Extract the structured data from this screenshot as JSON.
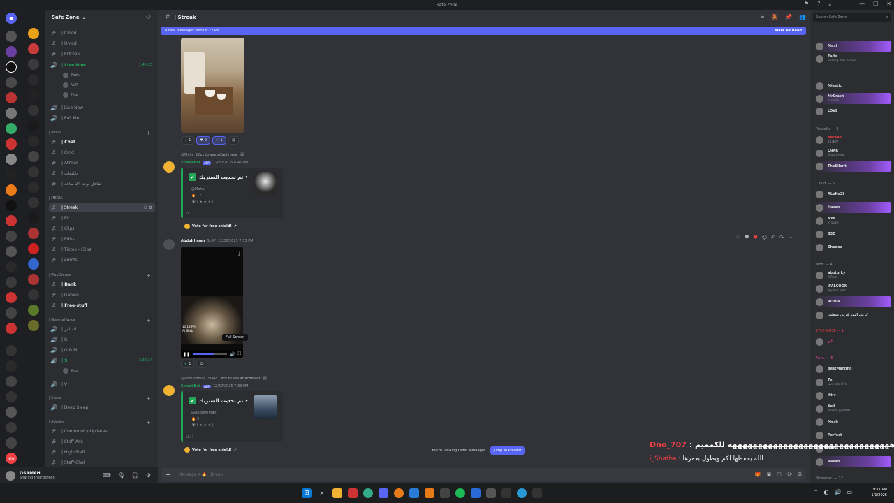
{
  "window": {
    "title": "Safe Zone"
  },
  "server": {
    "name": "Safe Zone"
  },
  "channel": {
    "name": "| Streak",
    "composer_placeholder": "Message #🔥| Streak"
  },
  "new_messages_bar": {
    "text": "8 new messages since 8:22 PM",
    "mark_as_read": "Mark As Read"
  },
  "sidebar": {
    "channels_top": [
      {
        "icon": "#",
        "name": "| Cmod"
      },
      {
        "icon": "#",
        "name": "| Umod"
      },
      {
        "icon": "#",
        "name": "| Pstreak"
      }
    ],
    "live_now": {
      "name": "| Live Now",
      "time": "1:45:25"
    },
    "live_users": [
      "Fade",
      "VaP",
      "Nxe"
    ],
    "voice_more": [
      {
        "name": "| Live Now"
      },
      {
        "name": "| Pull Me"
      }
    ],
    "cat_public": "| Public",
    "public_channels": [
      {
        "name": "| Chat"
      },
      {
        "name": "| Cmd"
      },
      {
        "name": "| Athkar"
      },
      {
        "name": "| تكليفات"
      },
      {
        "name": "| تفاعل-بوت-24-ساعه"
      }
    ],
    "cat_media": "| MEDIA",
    "media_channels": [
      {
        "name": "| Streak"
      },
      {
        "name": "| Pic"
      },
      {
        "name": "| Clips"
      },
      {
        "name": "| Edits"
      },
      {
        "name": "| Tiktok - Clips"
      },
      {
        "name": "| emots"
      }
    ],
    "cat_playground": "| PlayGround",
    "playground_channels": [
      {
        "name": "| Bank"
      },
      {
        "name": "| Games"
      },
      {
        "name": "| Free-stuff"
      }
    ],
    "cat_general_voice": "| General Voice",
    "general_voice_channels": [
      {
        "name": "| السانير"
      },
      {
        "name": "| G"
      },
      {
        "name": "| O & M"
      },
      {
        "name": "| S",
        "time": "3:32:24"
      },
      {
        "name": "| V"
      }
    ],
    "s_user": "Roo",
    "cat_sleep": "| Sleep",
    "sleep_channels": [
      {
        "name": "| Deep Sleep"
      }
    ],
    "cat_admins": "| Admins",
    "admin_channels": [
      {
        "name": "| Community-Updates"
      },
      {
        "name": "| Staff-Ads"
      },
      {
        "name": "| High-Staff"
      },
      {
        "name": "| Staff-Chat"
      }
    ]
  },
  "user_panel": {
    "name": "OSAMAH",
    "status": "Sharing their screen"
  },
  "messages": {
    "reactions_1": [
      {
        "emoji": "✔",
        "count": "1"
      },
      {
        "emoji": "♥",
        "count": "2"
      },
      {
        "emoji": "♡",
        "count": "1"
      }
    ],
    "reply_1": {
      "user": "@Maha",
      "text": "Click to see attachment"
    },
    "bot_1": {
      "author": "StreakBot",
      "tag": "APP",
      "time": "12/30/2025 6:41 PM"
    },
    "embed_1": {
      "title": "تم تحديث الستريك •",
      "mention": "@Maha",
      "streak": "12",
      "footer": "v1.13"
    },
    "vote_1": "Vote for free shield!",
    "user_msg": {
      "author": "Abdulrhman",
      "tag": "SLRP",
      "time": "12/30/2025 7:33 PM"
    },
    "video": {
      "overlay_l1": "10:13 PM",
      "overlay_l2": "At Sheb",
      "tooltip": "Full Screen"
    },
    "reactions_2": [
      {
        "emoji": "✔",
        "count": "1"
      }
    ],
    "reply_2": {
      "user": "@Abdulrhman",
      "tag": "SLRP",
      "text": "Click to see attachment"
    },
    "bot_2": {
      "author": "StreakBot",
      "tag": "APP",
      "time": "12/30/2025 7:33 PM"
    },
    "embed_2": {
      "title": "تم تحديث الستريك •",
      "mention": "@Abdulrhman",
      "streak": "3",
      "footer": "v1.13"
    },
    "vote_2": "Vote for free shield!"
  },
  "jump_bar": {
    "text": "You're Viewing Older Messages",
    "button": "Jump To Present"
  },
  "members": {
    "search_placeholder": "Search Safe Zone",
    "rows_top": [
      {
        "name": "Maxi",
        "sub": ""
      },
      {
        "name": "Fade",
        "sub": "Sharing their screen"
      }
    ],
    "rows_a": [
      {
        "name": "Mjestic",
        "sub": ""
      },
      {
        "name": "MrCrash",
        "sub": "In voice"
      },
      {
        "name": "LOVE",
        "sub": ""
      }
    ],
    "group_peaceful": "Peaceful — 3",
    "rows_b": [
      {
        "name": "Baraah",
        "sub": "24 NOV"
      },
      {
        "name": "LNAR",
        "sub": "GhostSyetal"
      },
      {
        "name": "TheSilent",
        "sub": ""
      }
    ],
    "group_cloud": "Cloud. — 5",
    "rows_c": [
      {
        "name": "ALeNeZi",
        "sub": ""
      },
      {
        "name": "Hasan",
        "sub": ""
      },
      {
        "name": "Nxe",
        "sub": "In voice"
      },
      {
        "name": "S3D",
        "sub": ""
      },
      {
        "name": "Shodoo",
        "sub": ""
      }
    ],
    "group_mod": "Mod. — 4",
    "rows_d": [
      {
        "name": "aboturky",
        "sub": "A Rest"
      },
      {
        "name": "IFALCOON",
        "sub": "Try Your Best"
      },
      {
        "name": "RONIR",
        "sub": ""
      },
      {
        "name": "كرتي امور كرتي شطور",
        "sub": ""
      }
    ],
    "group_house": "270 HOUSE — 1",
    "rows_e": [
      {
        "name": "أبو...",
        "sub": ""
      }
    ],
    "group_aura": "Aura. — 5",
    "rows_f": [
      {
        "name": "BestMartino",
        "sub": ""
      },
      {
        "name": "7s",
        "sub": "Live kick s/7s"
      },
      {
        "name": "Ittiv",
        "sub": ""
      },
      {
        "name": "Keil",
        "sub": "discord.gg/WUU"
      },
      {
        "name": "Mesh",
        "sub": ""
      },
      {
        "name": "Perfect",
        "sub": ""
      },
      {
        "name": "Nim",
        "sub": ""
      },
      {
        "name": "Rakan",
        "sub": ""
      }
    ],
    "group_streamer": "Streamer. — 12"
  },
  "overlay": {
    "line1_name": "Dno_707",
    "line1_text": " : ههههههههههههههههههههههههههههههههه للكمميم",
    "line2_name": "i_Shatha",
    "line2_text": " : الله يحفظها لكم ويطول بعمرها"
  },
  "taskbar": {
    "time": "9:11 PM",
    "date": "1/1/2026"
  },
  "colors": {
    "blurple": "#5865f2",
    "green": "#23a55a",
    "red": "#f23f43"
  }
}
